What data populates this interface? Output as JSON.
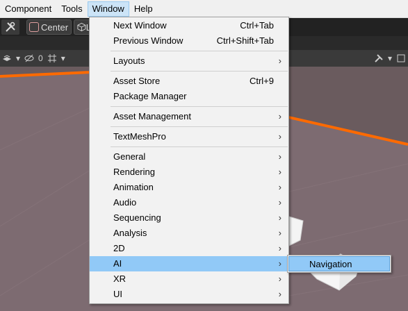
{
  "menubar": {
    "items": [
      "Component",
      "Tools",
      "Window",
      "Help"
    ],
    "open_index": 2
  },
  "toolbar": {
    "pivot_label": "Center",
    "space_label": "L"
  },
  "scene_toolbar": {
    "hidden_count": "0"
  },
  "window_menu": {
    "next_window": {
      "label": "Next Window",
      "shortcut": "Ctrl+Tab"
    },
    "previous_window": {
      "label": "Previous Window",
      "shortcut": "Ctrl+Shift+Tab"
    },
    "layouts": "Layouts",
    "asset_store": {
      "label": "Asset Store",
      "shortcut": "Ctrl+9"
    },
    "package_manager": "Package Manager",
    "asset_management": "Asset Management",
    "textmeshpro": "TextMeshPro",
    "general": "General",
    "rendering": "Rendering",
    "animation": "Animation",
    "audio": "Audio",
    "sequencing": "Sequencing",
    "analysis": "Analysis",
    "2d": "2D",
    "ai": "AI",
    "xr": "XR",
    "ui": "UI",
    "arrow": "›"
  },
  "ai_submenu": {
    "navigation": "Navigation"
  },
  "colors": {
    "menu_highlight": "#91c9f7",
    "menubar_open": "#cce4f7",
    "scene_edge": "#ff6a00"
  }
}
